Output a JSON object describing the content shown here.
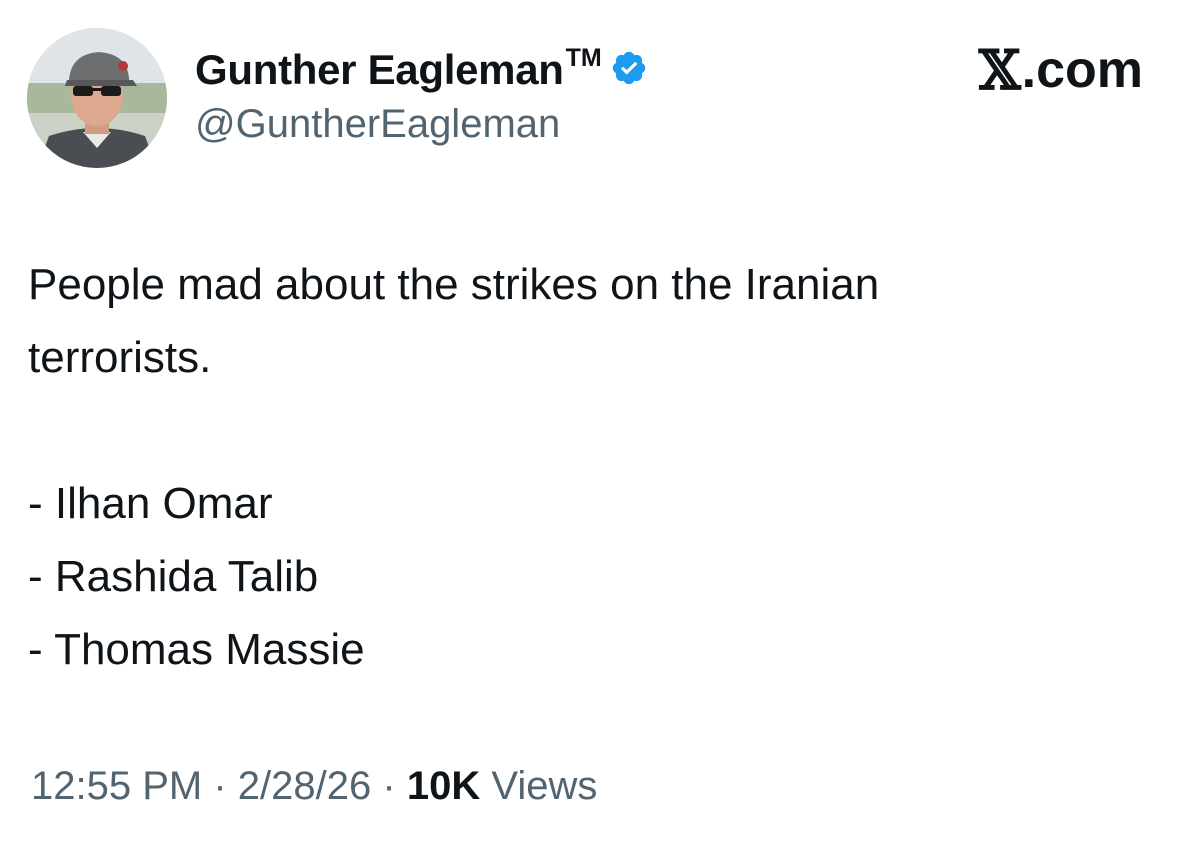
{
  "author": {
    "display_name": "Gunther Eagleman",
    "trademark": "TM",
    "handle": "@GuntherEagleman",
    "verified_icon": "verified-badge-icon",
    "verified_color": "#1d9bf0"
  },
  "brand": {
    "mark": "𝕏",
    "domain": ".com"
  },
  "tweet": {
    "text_line_1": "People mad about the strikes on the Iranian",
    "text_line_2": "terrorists.",
    "list": [
      "- Ilhan Omar",
      "- Rashida Talib",
      "- Thomas Massie"
    ]
  },
  "meta": {
    "time": "12:55 PM",
    "separator": "·",
    "date": "2/28/26",
    "views_count": "10K",
    "views_label": "Views"
  },
  "colors": {
    "text_primary": "#0f1419",
    "text_secondary": "#536471",
    "background": "#ffffff"
  }
}
